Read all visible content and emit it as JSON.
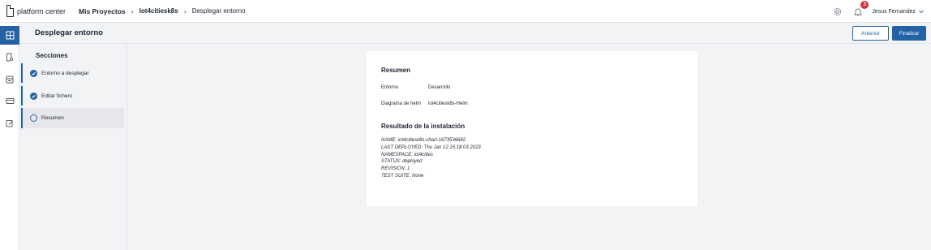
{
  "brand": {
    "name": "platform center"
  },
  "breadcrumb": {
    "root": "Mis Proyectos",
    "project": "Iot4citiesk8s",
    "current": "Desplegar entorno"
  },
  "header": {
    "notifications_count": "3",
    "user_name": "Jesus Fernandez"
  },
  "page": {
    "title": "Desplegar entorno",
    "prev_label": "Anterior",
    "finish_label": "Finalizar"
  },
  "sections": {
    "title": "Secciones",
    "steps": [
      {
        "label": "Entorno a desplegar",
        "status": "done"
      },
      {
        "label": "Editar fichero",
        "status": "done"
      },
      {
        "label": "Resumen",
        "status": "current"
      }
    ]
  },
  "summary": {
    "title": "Resumen",
    "env_label": "Entorno",
    "env_value": "Desarrollo",
    "helm_label": "Diagrama de helm",
    "helm_value": "iot4citiesk8s-Helm",
    "result_title": "Resultado de la instalación",
    "result_lines": [
      "NAME: iot4citiesk8s-chart-1673536682",
      "LAST DEPLOYED: Thu Jan 12 15:18:03 2023",
      "NAMESPACE: iot4cities",
      "STATUS: deployed",
      "REVISION: 1",
      "TEST SUITE: None"
    ]
  },
  "colors": {
    "accent": "#2462a6",
    "badge": "#d2333b",
    "background": "#f2f3f5"
  },
  "icons": [
    "grid-icon",
    "search-doc-icon",
    "storage-icon",
    "card-icon",
    "edit-icon",
    "gear-icon",
    "bell-icon",
    "chevron-down-icon",
    "check-circle-icon",
    "progress-circle-icon"
  ]
}
